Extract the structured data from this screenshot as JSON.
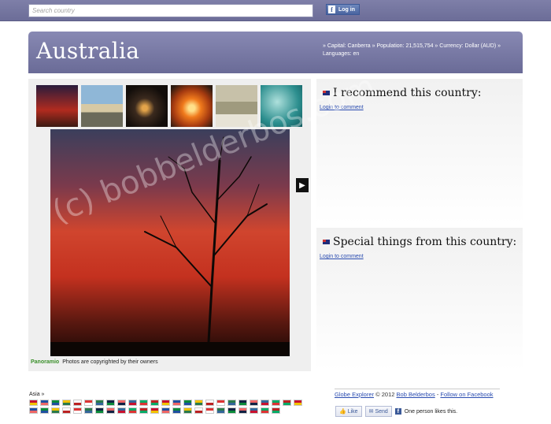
{
  "search": {
    "placeholder": "Search country"
  },
  "login": {
    "label": "Log in"
  },
  "country": {
    "name": "Australia",
    "facts_line1": "» Capital: Canberra » Population: 21,515,754 » Currency: Dollar (AUD) »",
    "facts_line2": "Languages: en"
  },
  "gallery": {
    "thumbnails": [
      "sunset-tree",
      "sydney-opera-house",
      "night-harbour",
      "desert-sunset",
      "wetland-path",
      "reef-lagoon"
    ],
    "credit_brand": "Panoramio",
    "credit_text": "Photos are copyrighted by their owners"
  },
  "recommend": {
    "title": "I recommend this country:",
    "login_link": "Login to comment"
  },
  "special": {
    "title": "Special things from this country:",
    "login_link": "Login to comment"
  },
  "footer": {
    "region": "Asia »",
    "site": "Globe Explorer",
    "copyright": "© 2012",
    "author": "Bob Belderbos",
    "sep": " - ",
    "follow": "Follow on Facebook",
    "like_label": "Like",
    "send_label": "Send",
    "likes_text": "One person likes this."
  },
  "watermark": "(c) bobbelderbos.com",
  "colors": {
    "header": "#7778a3",
    "link": "#2a4cb0"
  }
}
